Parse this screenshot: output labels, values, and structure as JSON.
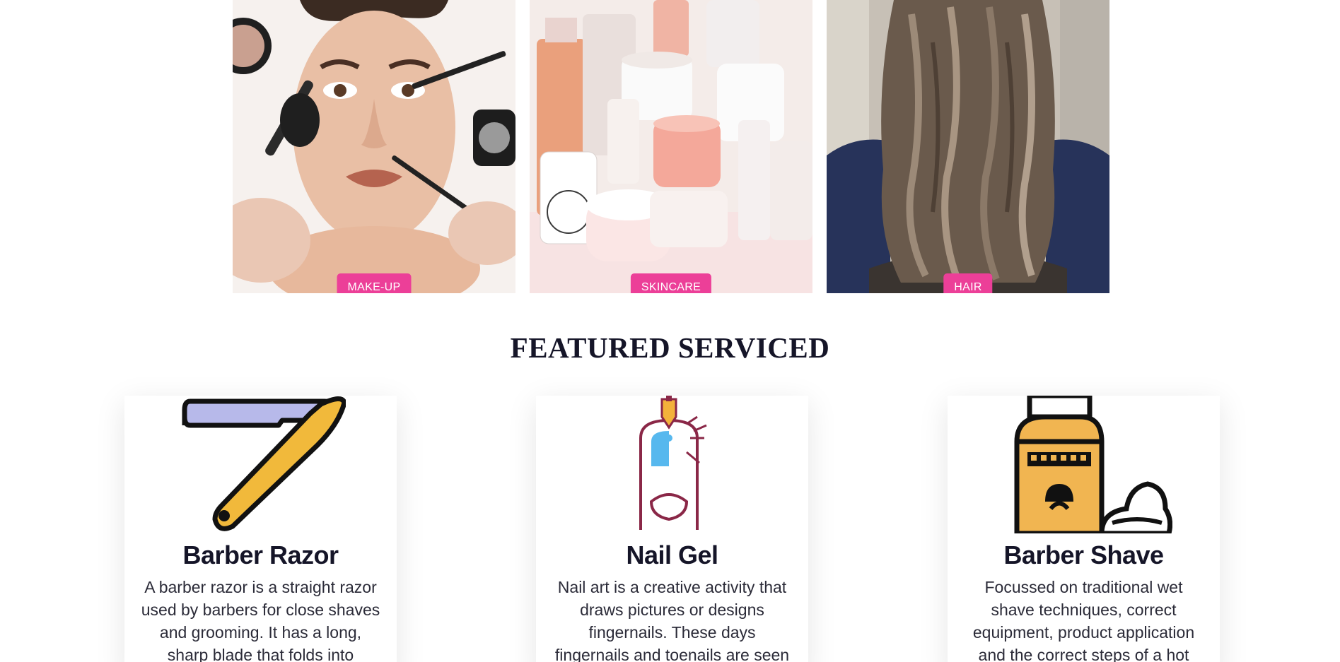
{
  "colors": {
    "accent": "#ec3f98",
    "heading": "#151528",
    "text": "#2b2b38"
  },
  "gallery": [
    {
      "label": "MAKE-UP"
    },
    {
      "label": "SKINCARE"
    },
    {
      "label": "HAIR"
    }
  ],
  "section": {
    "title": "FEATURED SERVICED"
  },
  "services": [
    {
      "icon": "razor-icon",
      "title": "Barber Razor",
      "description": "A barber razor is a straight razor used by barbers for close shaves and grooming. It has a long, sharp blade that folds into"
    },
    {
      "icon": "nail-gel-icon",
      "title": "Nail Gel",
      "description": "Nail art is a creative activity that draws pictures or designs fingernails. These days fingernails and toenails are seen"
    },
    {
      "icon": "shave-cream-icon",
      "title": "Barber Shave",
      "description": "Focussed on traditional wet shave techniques, correct equipment, product application and the correct steps of a hot"
    }
  ]
}
